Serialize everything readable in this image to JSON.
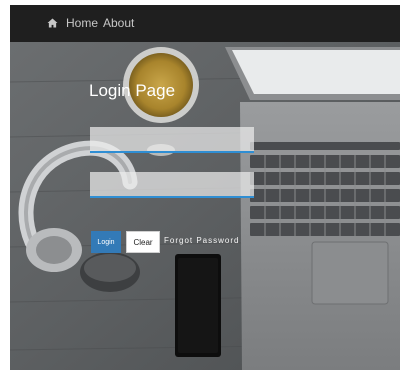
{
  "navbar": {
    "home_label": "Home",
    "about_label": "About",
    "home_icon": "home-icon",
    "background": "#1f1f1f",
    "text_color": "#c7c7c7"
  },
  "login": {
    "title": "Login Page",
    "username_value": "",
    "password_value": "",
    "login_label": "Login",
    "clear_label": "Clear",
    "forgot_label": "Forgot Password",
    "accent_color": "#2f8ed3",
    "login_button_color": "#337ab7"
  }
}
